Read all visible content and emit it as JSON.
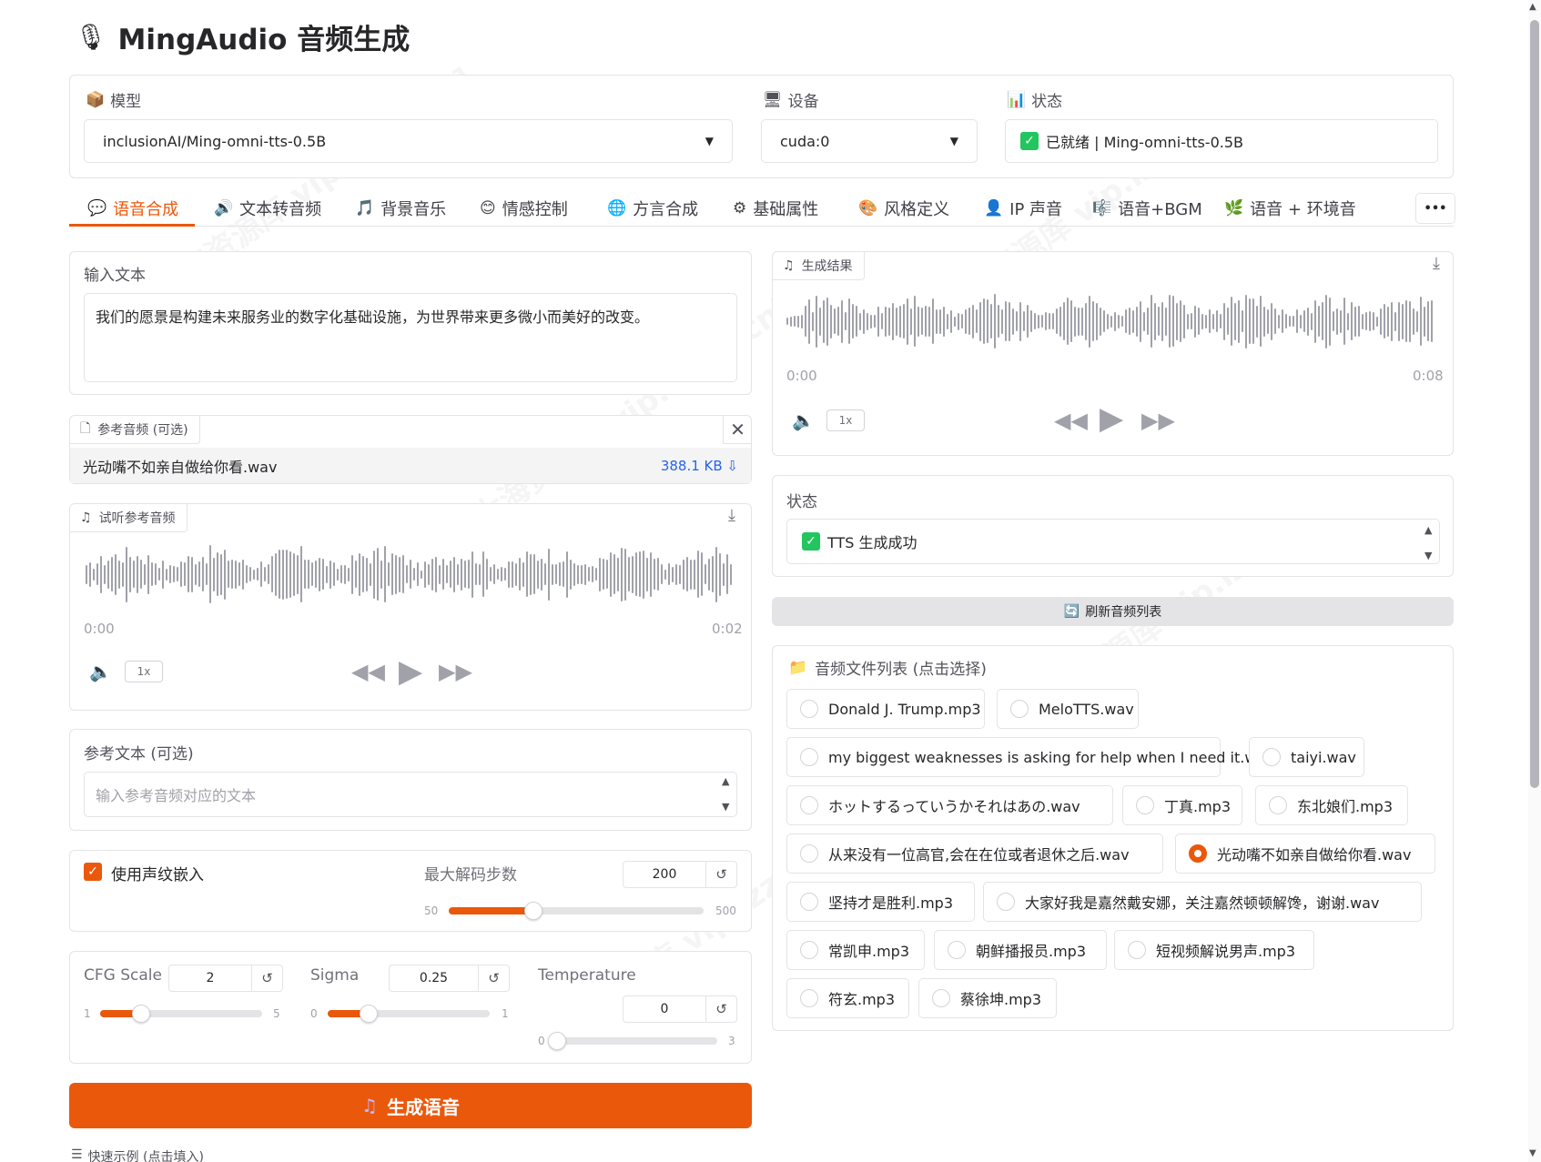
{
  "app": {
    "title": "MingAudio 音频生成"
  },
  "top": {
    "model_label": "模型",
    "model_value": "inclusionAI/Ming-omni-tts-0.5B",
    "device_label": "设备",
    "device_value": "cuda:0",
    "status_label": "状态",
    "status_value": "已就绪 | Ming-omni-tts-0.5B"
  },
  "tabs": [
    {
      "icon": "💬",
      "label": "语音合成"
    },
    {
      "icon": "🔊",
      "label": "文本转音频"
    },
    {
      "icon": "🎵",
      "label": "背景音乐"
    },
    {
      "icon": "😊",
      "label": "情感控制"
    },
    {
      "icon": "🌐",
      "label": "方言合成"
    },
    {
      "icon": "⚙",
      "label": "基础属性"
    },
    {
      "icon": "🎨",
      "label": "风格定义"
    },
    {
      "icon": "👤",
      "label": "IP 声音"
    },
    {
      "icon": "🎼",
      "label": "语音+BGM"
    },
    {
      "icon": "🌿",
      "label": "语音 + 环境音"
    }
  ],
  "tabs_more": "•••",
  "input_text": {
    "label": "输入文本",
    "value": "我们的愿景是构建未来服务业的数字化基础设施，为世界带来更多微小而美好的改变。"
  },
  "ref_audio": {
    "label": "参考音频 (可选)",
    "filename": "光动嘴不如亲自做给你看.wav",
    "size": "388.1 KB ⇩"
  },
  "preview": {
    "label": "试听参考音频",
    "time_start": "0:00",
    "time_end": "0:02",
    "speed": "1x"
  },
  "ref_text": {
    "label": "参考文本 (可选)",
    "placeholder": "输入参考音频对应的文本"
  },
  "voiceprint": {
    "label": "使用声纹嵌入",
    "checked": true,
    "max_steps_label": "最大解码步数",
    "max_steps_value": "200",
    "min": "50",
    "max": "500",
    "level": 0.333
  },
  "params": {
    "cfg_label": "CFG Scale",
    "cfg_value": "2",
    "cfg_min": "1",
    "cfg_max": "5",
    "cfg_level": 0.25,
    "sigma_label": "Sigma",
    "sigma_value": "0.25",
    "sigma_min": "0",
    "sigma_max": "1",
    "sigma_level": 0.25,
    "temp_label": "Temperature",
    "temp_value": "0",
    "temp_min": "0",
    "temp_max": "3",
    "temp_level": 0
  },
  "generate_button": "生成语音",
  "quick_examples": "快速示例 (点击填入)",
  "result": {
    "label": "生成结果",
    "time_start": "0:00",
    "time_end": "0:08",
    "speed": "1x"
  },
  "status": {
    "label": "状态",
    "value": "TTS 生成成功"
  },
  "refresh_button": "刷新音频列表",
  "file_list": {
    "label": "音频文件列表 (点击选择)",
    "selected": "光动嘴不如亲自做给你看.wav",
    "items": [
      "Donald J. Trump.mp3",
      "MeloTTS.wav",
      "my biggest weaknesses is asking for help when I need it.wav",
      "taiyi.wav",
      "ホットするっていうかそれはあの.wav",
      "丁真.mp3",
      "东北娘们.mp3",
      "从来没有一位高官,会在在位或者退休之后.wav",
      "光动嘴不如亲自做给你看.wav",
      "坚持才是胜利.mp3",
      "大家好我是嘉然戴安娜，关注嘉然顿顿解馋，谢谢.wav",
      "常凯申.mp3",
      "朝鲜播报员.mp3",
      "短视频解说男声.mp3",
      "符玄.mp3",
      "蔡徐坤.mp3"
    ]
  },
  "watermark": "[大海资源库 vip.lzzcc.cn]",
  "colors": {
    "accent": "#ea580c",
    "success": "#22c55e",
    "border": "#e4e4e7"
  }
}
